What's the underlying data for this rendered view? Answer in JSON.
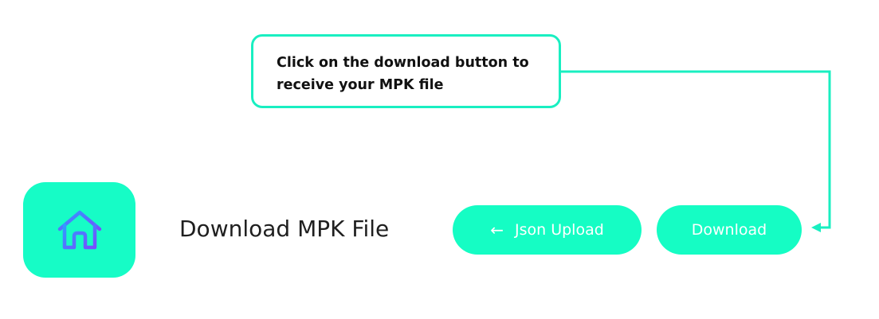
{
  "callout": {
    "text": "Click on the download button to\nreceive your MPK file"
  },
  "header": {
    "title": "Download MPK File",
    "home_icon": "home-icon"
  },
  "actions": {
    "json_upload": {
      "icon": "arrow-left-icon",
      "icon_glyph": "←",
      "label": "Json Upload"
    },
    "download": {
      "label": "Download"
    }
  },
  "colors": {
    "accent": "#15fdc4",
    "callout_border": "#19efc1",
    "icon_gradient_start": "#2f9bff",
    "icon_gradient_end": "#7a4cff",
    "title_text": "#1f1f1f"
  }
}
